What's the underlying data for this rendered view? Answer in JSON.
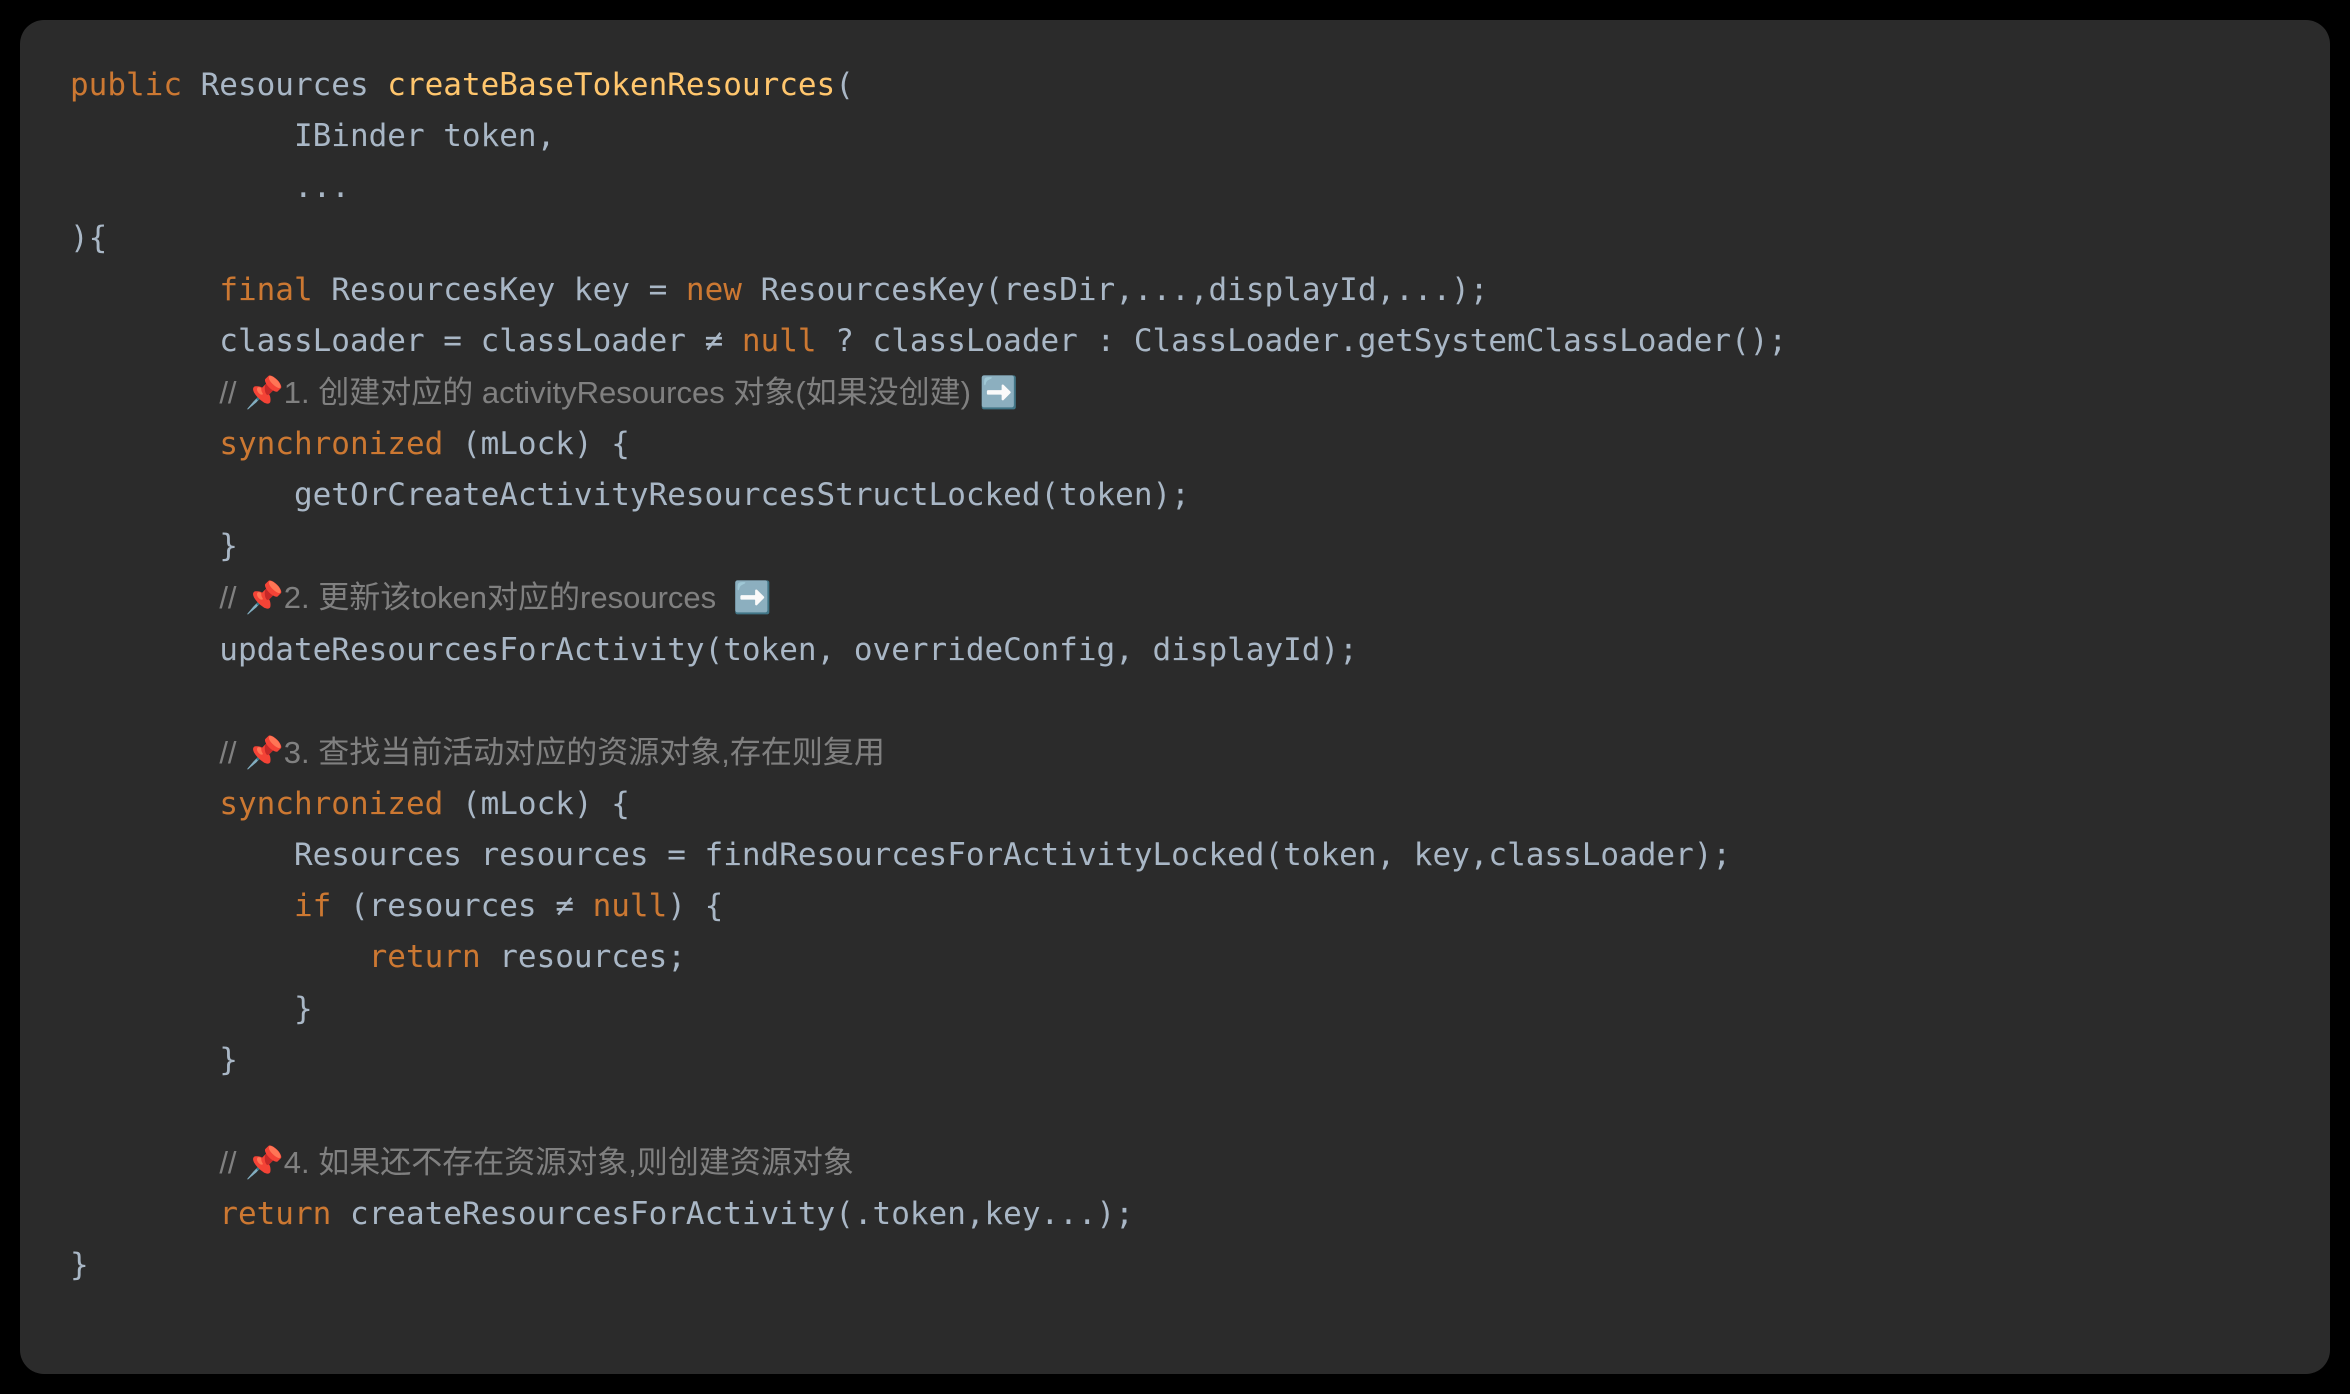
{
  "code": {
    "line1_kw": "public",
    "line1_type": " Resources ",
    "line1_method": "createBaseTokenResources",
    "line1_paren": "(",
    "line2": "            IBinder token,",
    "line3": "            ...",
    "line4": "){",
    "line5_indent": "        ",
    "line5_kw": "final",
    "line5_a": " ResourcesKey key = ",
    "line5_kw2": "new",
    "line5_b": " ResourcesKey(resDir,...,displayId,...);",
    "line6": "        classLoader = classLoader ≠ ",
    "line6_null": "null",
    "line6_b": " ? classLoader : ClassLoader.getSystemClassLoader();",
    "line7_indent": "        ",
    "line7_comment": "// 📌1. 创建对应的 activityResources 对象(如果没创建) ➡️",
    "line8_indent": "        ",
    "line8_kw": "synchronized",
    "line8_rest": " (mLock) {",
    "line9": "            getOrCreateActivityResourcesStructLocked(token);",
    "line10": "        }",
    "line11_indent": "        ",
    "line11_comment": "// 📌2. 更新该token对应的resources  ➡️",
    "line12": "        updateResourcesForActivity(token, overrideConfig, displayId);",
    "line13": "",
    "line14_indent": "        ",
    "line14_comment": "// 📌3. 查找当前活动对应的资源对象,存在则复用",
    "line15_indent": "        ",
    "line15_kw": "synchronized",
    "line15_rest": " (mLock) {",
    "line16": "            Resources resources = findResourcesForActivityLocked(token, key,classLoader);",
    "line17_indent": "            ",
    "line17_kw": "if",
    "line17_a": " (resources ≠ ",
    "line17_null": "null",
    "line17_b": ") {",
    "line18_indent": "                ",
    "line18_kw": "return",
    "line18_rest": " resources;",
    "line19": "            }",
    "line20": "        }",
    "line21": "",
    "line22_indent": "        ",
    "line22_comment": "// 📌4. 如果还不存在资源对象,则创建资源对象",
    "line23_indent": "        ",
    "line23_kw": "return",
    "line23_rest": " createResourcesForActivity(.token,key...);",
    "line24": "}"
  }
}
